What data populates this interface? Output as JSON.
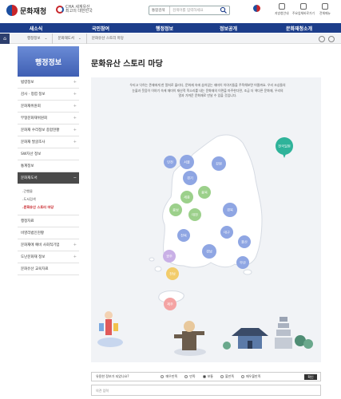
{
  "header": {
    "logo": "문화재청",
    "sublogo": "CHA 세계유산 최고의 대한민국",
    "search_select": "통합검색",
    "search_placeholder": "검색어를 입력하세요",
    "util": [
      "지방청안내",
      "주요업체바로가기",
      "전체메뉴"
    ]
  },
  "gnb": [
    "새소식",
    "국민참여",
    "행정정보",
    "정보공개",
    "문화재청소개"
  ],
  "breadcrumb": [
    "행정정보",
    "문화재도서",
    "문화유산 스토리 마당"
  ],
  "sidebar": {
    "title": "행정정보",
    "items": [
      "법령정보",
      "감사 · 청렴 정보",
      "문화재위원회",
      "무형문화재위원회",
      "문화재 수리정보 종합현황",
      "문화재 발굴조사",
      "SW자산 정보",
      "통계정보",
      "문화재도서"
    ],
    "sub_items": [
      "간행물",
      "도서검색",
      "문화유산 스토리 마당"
    ],
    "items_after": [
      "행정자료",
      "비영리법인현황",
      "문화재에 예비 사회적기업",
      "도난문화재 정보",
      "문화유산 교육자료"
    ]
  },
  "content": {
    "title": "문화유산 스토리 마당",
    "intro": [
      "우리고 익히는 존재에게 한 알처로 물리다, 문화재 속에 숨어있는 재미이 이야기들을 주목해보면 어떨까요. 우리 조상들의",
      "눈물과 웃음이 이야기 속에 재미이 재산적 목소리를 내는 문화재의 이면을 마주한다면, 조금 더 색다른 문화재, 우리의",
      "얼과 가까운 문화재로 만날 수 있을 것입니다."
    ]
  },
  "regions": [
    {
      "label": "전국일원",
      "color": "#2fb39a"
    },
    {
      "label": "인천",
      "color": "#8fa6e3"
    },
    {
      "label": "서울",
      "color": "#8fa6e3"
    },
    {
      "label": "강원",
      "color": "#8fa6e3"
    },
    {
      "label": "경기",
      "color": "#8fa6e3"
    },
    {
      "label": "충남",
      "color": "#9cd08b"
    },
    {
      "label": "세종",
      "color": "#9cd08b"
    },
    {
      "label": "충북",
      "color": "#9cd08b"
    },
    {
      "label": "대전",
      "color": "#9cd08b"
    },
    {
      "label": "경북",
      "color": "#8fa6e3"
    },
    {
      "label": "전북",
      "color": "#8fa6e3"
    },
    {
      "label": "대구",
      "color": "#8fa6e3"
    },
    {
      "label": "광주",
      "color": "#c9b0e6"
    },
    {
      "label": "경남",
      "color": "#8fa6e3"
    },
    {
      "label": "전남",
      "color": "#f2cc6b"
    },
    {
      "label": "부산",
      "color": "#8fa6e3"
    },
    {
      "label": "울산",
      "color": "#8fa6e3"
    },
    {
      "label": "제주",
      "color": "#f4a3a3"
    }
  ],
  "survey": {
    "question": "유용한 정보가 되었나요?",
    "options": [
      "매우만족",
      "만족",
      "보통",
      "불만족",
      "매우불만족"
    ],
    "selected": 2,
    "submit": "확인",
    "opinion_placeholder": "의견 입력"
  },
  "colors": {
    "gnb": "#1c3d8a",
    "sidebar_title": "#4f6fc4",
    "accent": "#c8262b"
  }
}
